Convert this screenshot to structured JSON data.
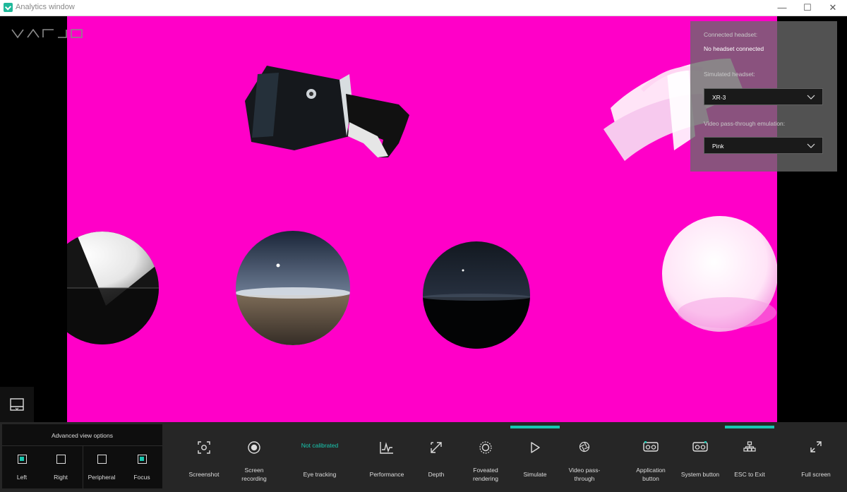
{
  "window": {
    "title": "Analytics window",
    "controls": [
      "—",
      "☐",
      "✕"
    ]
  },
  "logo": "VARJO",
  "settings": {
    "connected_label": "Connected headset:",
    "connected_value": "No headset connected",
    "simulated_label": "Simulated headset:",
    "simulated_value": "XR-3",
    "passthrough_label": "Video pass-through emulation:",
    "passthrough_value": "Pink"
  },
  "advanced": {
    "title": "Advanced view options",
    "options": [
      {
        "label": "Left",
        "checked": true
      },
      {
        "label": "Right",
        "checked": false
      },
      {
        "label": "Peripheral",
        "checked": false
      },
      {
        "label": "Focus",
        "checked": true
      }
    ]
  },
  "toolbar": {
    "screenshot": "Screenshot",
    "screen_recording": [
      "Screen",
      "recording"
    ],
    "eye_tracking_status": "Not calibrated",
    "eye_tracking": "Eye tracking",
    "performance": "Performance",
    "depth": "Depth",
    "foveated": [
      "Foveated",
      "rendering"
    ],
    "simulate": "Simulate",
    "video_passthrough": [
      "Video pass-",
      "through"
    ],
    "application_button": [
      "Application",
      "button"
    ],
    "system_button": "System button",
    "esc_exit": "ESC to Exit",
    "full_screen": "Full screen"
  },
  "colors": {
    "accent": "#18c8b0",
    "viewport_background": "#ff00c8"
  }
}
